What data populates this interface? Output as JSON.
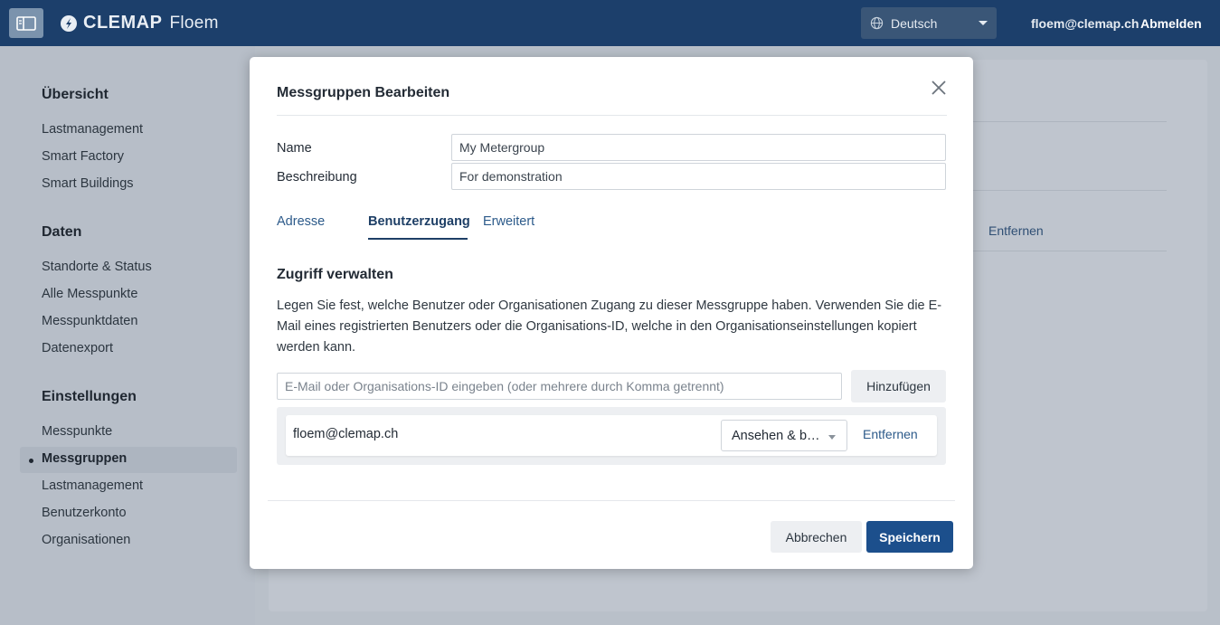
{
  "header": {
    "brand_name": "CLEMAP",
    "product_name": "Floem",
    "language": "Deutsch",
    "user_email": "floem@clemap.ch",
    "logout_label": "Abmelden"
  },
  "sidebar": {
    "sections": [
      {
        "heading": "Übersicht",
        "items": [
          "Lastmanagement",
          "Smart Factory",
          "Smart Buildings"
        ]
      },
      {
        "heading": "Daten",
        "items": [
          "Standorte & Status",
          "Alle Messpunkte",
          "Messpunktdaten",
          "Datenexport"
        ]
      },
      {
        "heading": "Einstellungen",
        "items": [
          "Messpunkte",
          "Messgruppen",
          "Lastmanagement",
          "Benutzerkonto",
          "Organisationen"
        ]
      }
    ],
    "active_item": "Messgruppen"
  },
  "background": {
    "remove_label": "Entfernen"
  },
  "modal": {
    "title": "Messgruppen Bearbeiten",
    "name_label": "Name",
    "name_value": "My Metergroup",
    "description_label": "Beschreibung",
    "description_value": "For demonstration",
    "tabs": [
      "Adresse",
      "Benutzerzugang",
      "Erweitert"
    ],
    "active_tab": "Benutzerzugang",
    "section_title": "Zugriff verwalten",
    "section_description": "Legen Sie fest, welche Benutzer oder Organisationen Zugang zu dieser Messgruppe haben. Verwenden Sie die E-Mail eines registrierten Benutzers oder die Organisations-ID, welche in den Organisationseinstellungen kopiert werden kann.",
    "access_placeholder": "E-Mail oder Organisations-ID eingeben (oder mehrere durch Komma getrennt)",
    "add_label": "Hinzufügen",
    "access_entries": [
      {
        "email": "floem@clemap.ch",
        "permission": "Ansehen & bearbeiten",
        "remove_label": "Entfernen"
      }
    ],
    "cancel_label": "Abbrechen",
    "save_label": "Speichern"
  },
  "colors": {
    "header_bg": "#1c3f6b",
    "primary": "#1c4f8c",
    "link": "#2c5a8a"
  }
}
